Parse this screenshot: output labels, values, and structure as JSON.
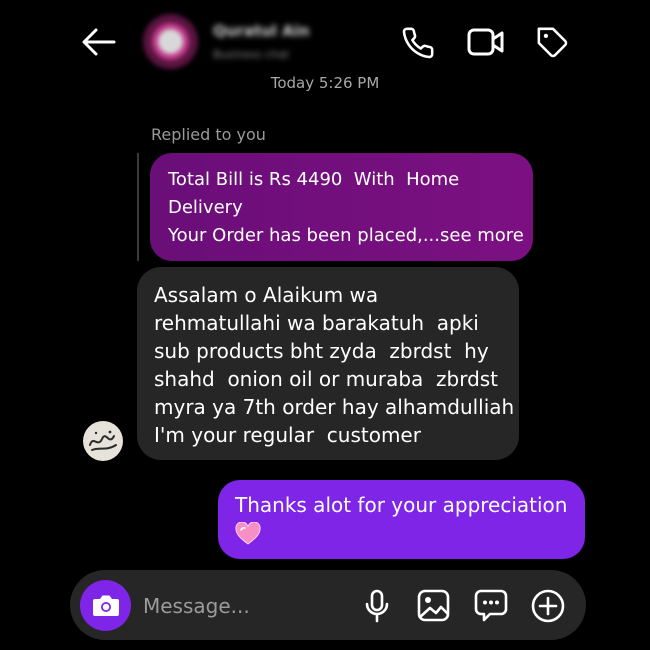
{
  "header": {
    "contact_name": "Quratul Ain",
    "contact_status": "Business chat",
    "icons": [
      "back-arrow-icon",
      "phone-icon",
      "video-camera-icon",
      "tag-icon"
    ]
  },
  "conversation": {
    "timestamp": "Today 5:26 PM",
    "reply_label": "Replied to you",
    "replied_message_lines": [
      "Total Bill is Rs 4490  With  Home",
      "Delivery",
      "Your Order has been placed,...see more"
    ],
    "incoming_message_lines": [
      "Assalam o Alaikum wa",
      "rehmatullahi wa barakatuh  apki",
      "sub products bht zyda  zbrdst  hy",
      "shahd  onion oil or muraba  zbrdst",
      "myra ya 7th order hay alhamdulliah",
      "I'm your regular  customer"
    ],
    "outgoing_message": "Thanks alot for your appreciation",
    "outgoing_emoji": "pink-heart-icon"
  },
  "composer": {
    "placeholder": "Message...",
    "value": "",
    "icons": [
      "camera-icon",
      "microphone-icon",
      "gallery-icon",
      "sticker-icon",
      "plus-icon"
    ]
  },
  "colors": {
    "background": "#000000",
    "replied_bubble": "#6e0f7c",
    "incoming_bubble": "#262626",
    "outgoing_bubble": "#7f25e8",
    "camera_button": "#7f25e8"
  }
}
